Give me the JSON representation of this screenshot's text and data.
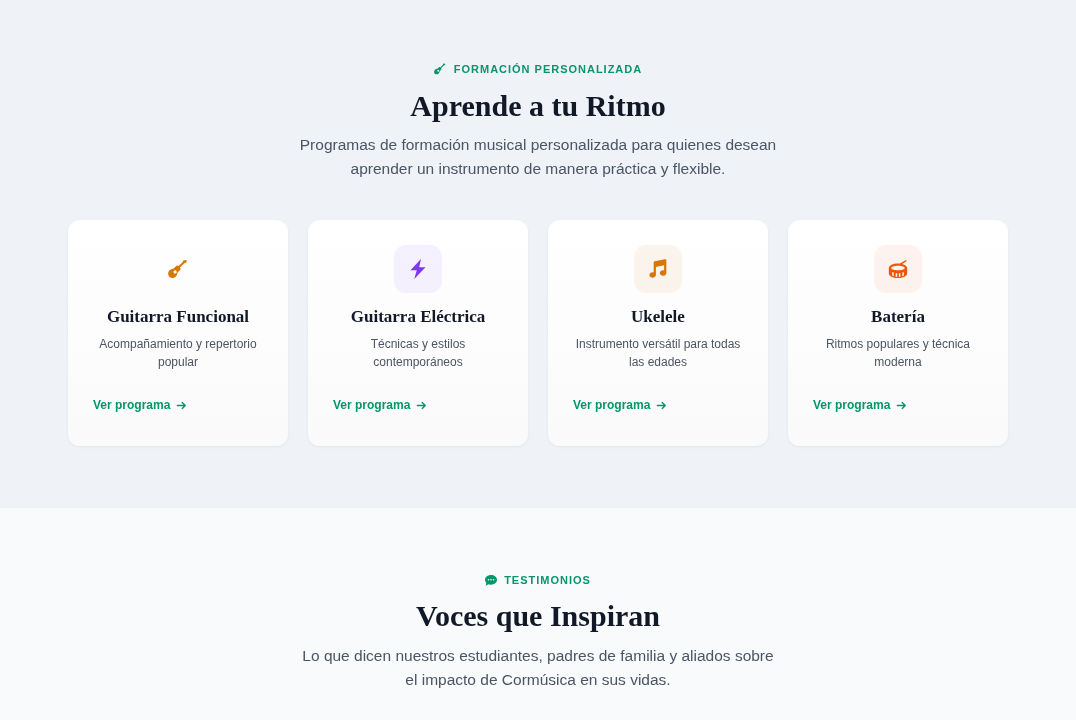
{
  "programs_section": {
    "eyebrow": "FORMACIÓN PERSONALIZADA",
    "title": "Aprende a tu Ritmo",
    "description": "Programas de formación musical personalizada para quienes desean aprender un instrumento de manera práctica y flexible.",
    "programs": [
      {
        "title": "Guitarra Funcional",
        "description": "Acompañamiento y repertorio popular",
        "link": "Ver programa",
        "color": "#d97706",
        "tile": false
      },
      {
        "title": "Guitarra Eléctrica",
        "description": "Técnicas y estilos contemporáneos",
        "link": "Ver programa",
        "color": "#7c3aed",
        "tile": true
      },
      {
        "title": "Ukelele",
        "description": "Instrumento versátil para todas las edades",
        "link": "Ver programa",
        "color": "#d97706",
        "tile": true
      },
      {
        "title": "Batería",
        "description": "Ritmos populares y técnica moderna",
        "link": "Ver programa",
        "color": "#ea580c",
        "tile": true
      }
    ]
  },
  "testimonials_section": {
    "eyebrow": "TESTIMONIOS",
    "title": "Voces que Inspiran",
    "description": "Lo que dicen nuestros estudiantes, padres de familia y aliados sobre el impacto de Cormúsica en sus vidas."
  }
}
